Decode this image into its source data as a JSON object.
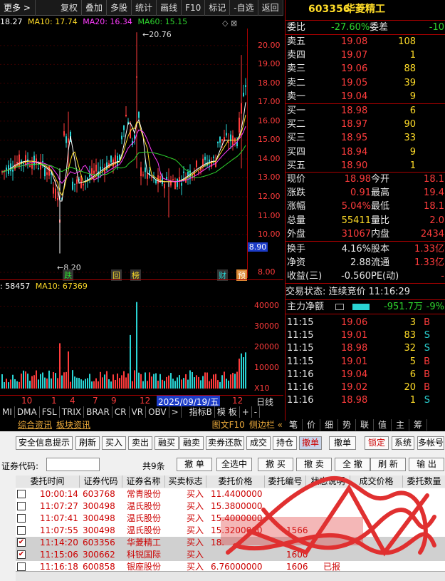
{
  "toolbar": {
    "more": "更多 >",
    "items": [
      "复权",
      "叠加",
      "多股",
      "统计",
      "画线",
      "F10",
      "标记",
      "-自选",
      "返回"
    ]
  },
  "ma_line": {
    "ma5": "18.27",
    "ma10": "MA10: 17.74",
    "ma20": "MA20: 16.34",
    "ma60": "MA60: 15.15"
  },
  "price_axis": [
    "20.00",
    "19.00",
    "18.00",
    "17.00",
    "16.00",
    "15.00",
    "14.00",
    "13.00",
    "12.00",
    "11.00",
    "10.00",
    "8.00"
  ],
  "price_current_tag": "8.90",
  "high_mark": "20.76",
  "low_mark": "8.20",
  "event_tags": [
    "跌",
    "回",
    "榜",
    "财",
    "预"
  ],
  "vol_line": {
    "vol": ": 58457",
    "ma10": "MA10: 67369"
  },
  "vol_axis": [
    "40000",
    "30000",
    "20000",
    "10000",
    "X10"
  ],
  "date_ticks": [
    "10",
    "1",
    "4",
    "7",
    "9",
    "12",
    "2025/09/19/五",
    "12"
  ],
  "date_axis_label": "日线",
  "indicator_tabs": [
    "MI",
    "DMA",
    "FSL",
    "TRIX",
    "BRAR",
    "CR",
    "VR",
    "OBV",
    ">",
    "指标B",
    "模 板",
    "+",
    "-"
  ],
  "sub_tabs": [
    "综合资讯",
    "板块资讯"
  ],
  "sub_tabs_right": [
    "图文F10",
    "侧边栏 «"
  ],
  "stock": {
    "code": "603356",
    "name": "华菱精工"
  },
  "order_book": {
    "weibi_label": "委比",
    "weibi": "-27.60%",
    "weicha_label": "委差",
    "weicha": "-10",
    "asks": [
      {
        "label": "卖五",
        "price": "19.08",
        "vol": "108"
      },
      {
        "label": "卖四",
        "price": "19.07",
        "vol": "1"
      },
      {
        "label": "卖三",
        "price": "19.06",
        "vol": "88"
      },
      {
        "label": "卖二",
        "price": "19.05",
        "vol": "39"
      },
      {
        "label": "卖一",
        "price": "19.04",
        "vol": "9"
      }
    ],
    "bids": [
      {
        "label": "买一",
        "price": "18.98",
        "vol": "6"
      },
      {
        "label": "买二",
        "price": "18.97",
        "vol": "90"
      },
      {
        "label": "买三",
        "price": "18.95",
        "vol": "33"
      },
      {
        "label": "买四",
        "price": "18.94",
        "vol": "9"
      },
      {
        "label": "买五",
        "price": "18.90",
        "vol": "1"
      }
    ]
  },
  "quote": [
    {
      "l": "现价",
      "v": "18.98",
      "l2": "今开",
      "v2": "18.1"
    },
    {
      "l": "涨跌",
      "v": "0.91",
      "l2": "最高",
      "v2": "19.4"
    },
    {
      "l": "涨幅",
      "v": "5.04%",
      "l2": "最低",
      "v2": "18.1"
    },
    {
      "l": "总量",
      "v": "55411",
      "l2": "量比",
      "v2": "2.0"
    },
    {
      "l": "外盘",
      "v": "31067",
      "l2": "内盘",
      "v2": "2434"
    }
  ],
  "quote2": [
    {
      "l": "换手",
      "v": "4.16%",
      "l2": "股本",
      "v2": "1.33亿"
    },
    {
      "l": "净资",
      "v": "2.88",
      "l2": "流通",
      "v2": "1.33亿"
    },
    {
      "l": "收益(三)",
      "v": "-0.560",
      "l2": "PE(动)",
      "v2": "-"
    }
  ],
  "trade_status": "交易状态: 连续竞价 11:16:29",
  "main_force": {
    "label": "主力净额",
    "value": "-951.7万",
    "pct": "-9%"
  },
  "ticks": [
    {
      "t": "11:15",
      "p": "19.06",
      "v": "3",
      "d": "B"
    },
    {
      "t": "11:15",
      "p": "19.01",
      "v": "83",
      "d": "S"
    },
    {
      "t": "11:15",
      "p": "18.98",
      "v": "32",
      "d": "S"
    },
    {
      "t": "11:15",
      "p": "19.01",
      "v": "5",
      "d": "B"
    },
    {
      "t": "11:16",
      "p": "19.04",
      "v": "6",
      "d": "B"
    },
    {
      "t": "11:16",
      "p": "19.02",
      "v": "20",
      "d": "B"
    },
    {
      "t": "11:16",
      "p": "18.98",
      "v": "1",
      "d": "S"
    }
  ],
  "panel_tabs": [
    "笔",
    "价",
    "细",
    "势",
    "联",
    "值",
    "主",
    "筹"
  ],
  "trade": {
    "buttons": [
      "安全信息提示",
      "刷新",
      "买入",
      "卖出",
      "融买",
      "融卖",
      "卖券还款",
      "成交",
      "持仓",
      "撤单",
      "撤单",
      "锁定",
      "系统",
      "多帐号"
    ],
    "code_label": "证券代码:",
    "count": "共9条",
    "actions": [
      "撤 单",
      "全选中",
      "撤 买",
      "撤 卖",
      "全 撤",
      "刷 新",
      "输 出"
    ],
    "headers": [
      "委托时间",
      "证券代码",
      "证券名称",
      "买卖标志",
      "委托价格",
      "委托编号",
      "状态说明",
      "成交价格",
      "委托数量"
    ],
    "rows": [
      {
        "time": "10:00:14",
        "code": "603768",
        "name": "常青股份",
        "side": "买入",
        "price": "11.4400000",
        "no": "",
        "status": "",
        "checked": false
      },
      {
        "time": "11:07:27",
        "code": "300498",
        "name": "温氏股份",
        "side": "买入",
        "price": "15.3800000",
        "no": "",
        "status": "",
        "checked": false
      },
      {
        "time": "11:07:41",
        "code": "300498",
        "name": "温氏股份",
        "side": "买入",
        "price": "15.4000000",
        "no": "",
        "status": "",
        "checked": false
      },
      {
        "time": "11:07:55",
        "code": "300498",
        "name": "温氏股份",
        "side": "买入",
        "price": "15.3200000",
        "no": "1566",
        "status": "",
        "checked": false
      },
      {
        "time": "11:14:20",
        "code": "603356",
        "name": "华菱精工",
        "side": "买入",
        "price": "18.",
        "no": "",
        "status": "",
        "checked": true
      },
      {
        "time": "11:15:06",
        "code": "300662",
        "name": "科锐国际",
        "side": "买入",
        "price": "",
        "no": "1600",
        "status": "",
        "checked": true
      },
      {
        "time": "11:16:18",
        "code": "600858",
        "name": "银座股份",
        "side": "买入",
        "price": "6.76000000",
        "no": "1606",
        "status": "已报",
        "checked": false
      }
    ]
  },
  "colors": {
    "up": "#ff3c3c",
    "down": "#2ed52e",
    "ma5": "#ffffff",
    "ma10": "#ffdc28",
    "ma20": "#ff3cff",
    "ma60": "#2ed52e"
  }
}
